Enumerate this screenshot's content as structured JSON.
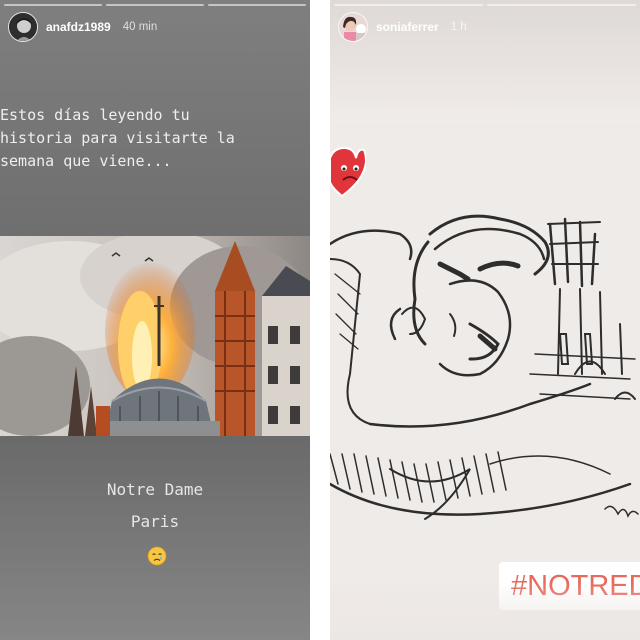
{
  "left_story": {
    "username": "anafdz1989",
    "time_ago": "40 min",
    "text_lines": [
      "Estos días leyendo tu",
      "historia para visitarte la",
      "semana que viene..."
    ],
    "caption_line1": "Notre Dame",
    "caption_line2": "Paris",
    "emoji": "crying-face"
  },
  "right_story": {
    "username": "soniaferrer",
    "time_ago": "1 h",
    "sticker": "sad-heart",
    "hashtag": "#NOTREDA"
  },
  "colors": {
    "hashtag": "#e8685a",
    "heart": "#e0353b"
  }
}
